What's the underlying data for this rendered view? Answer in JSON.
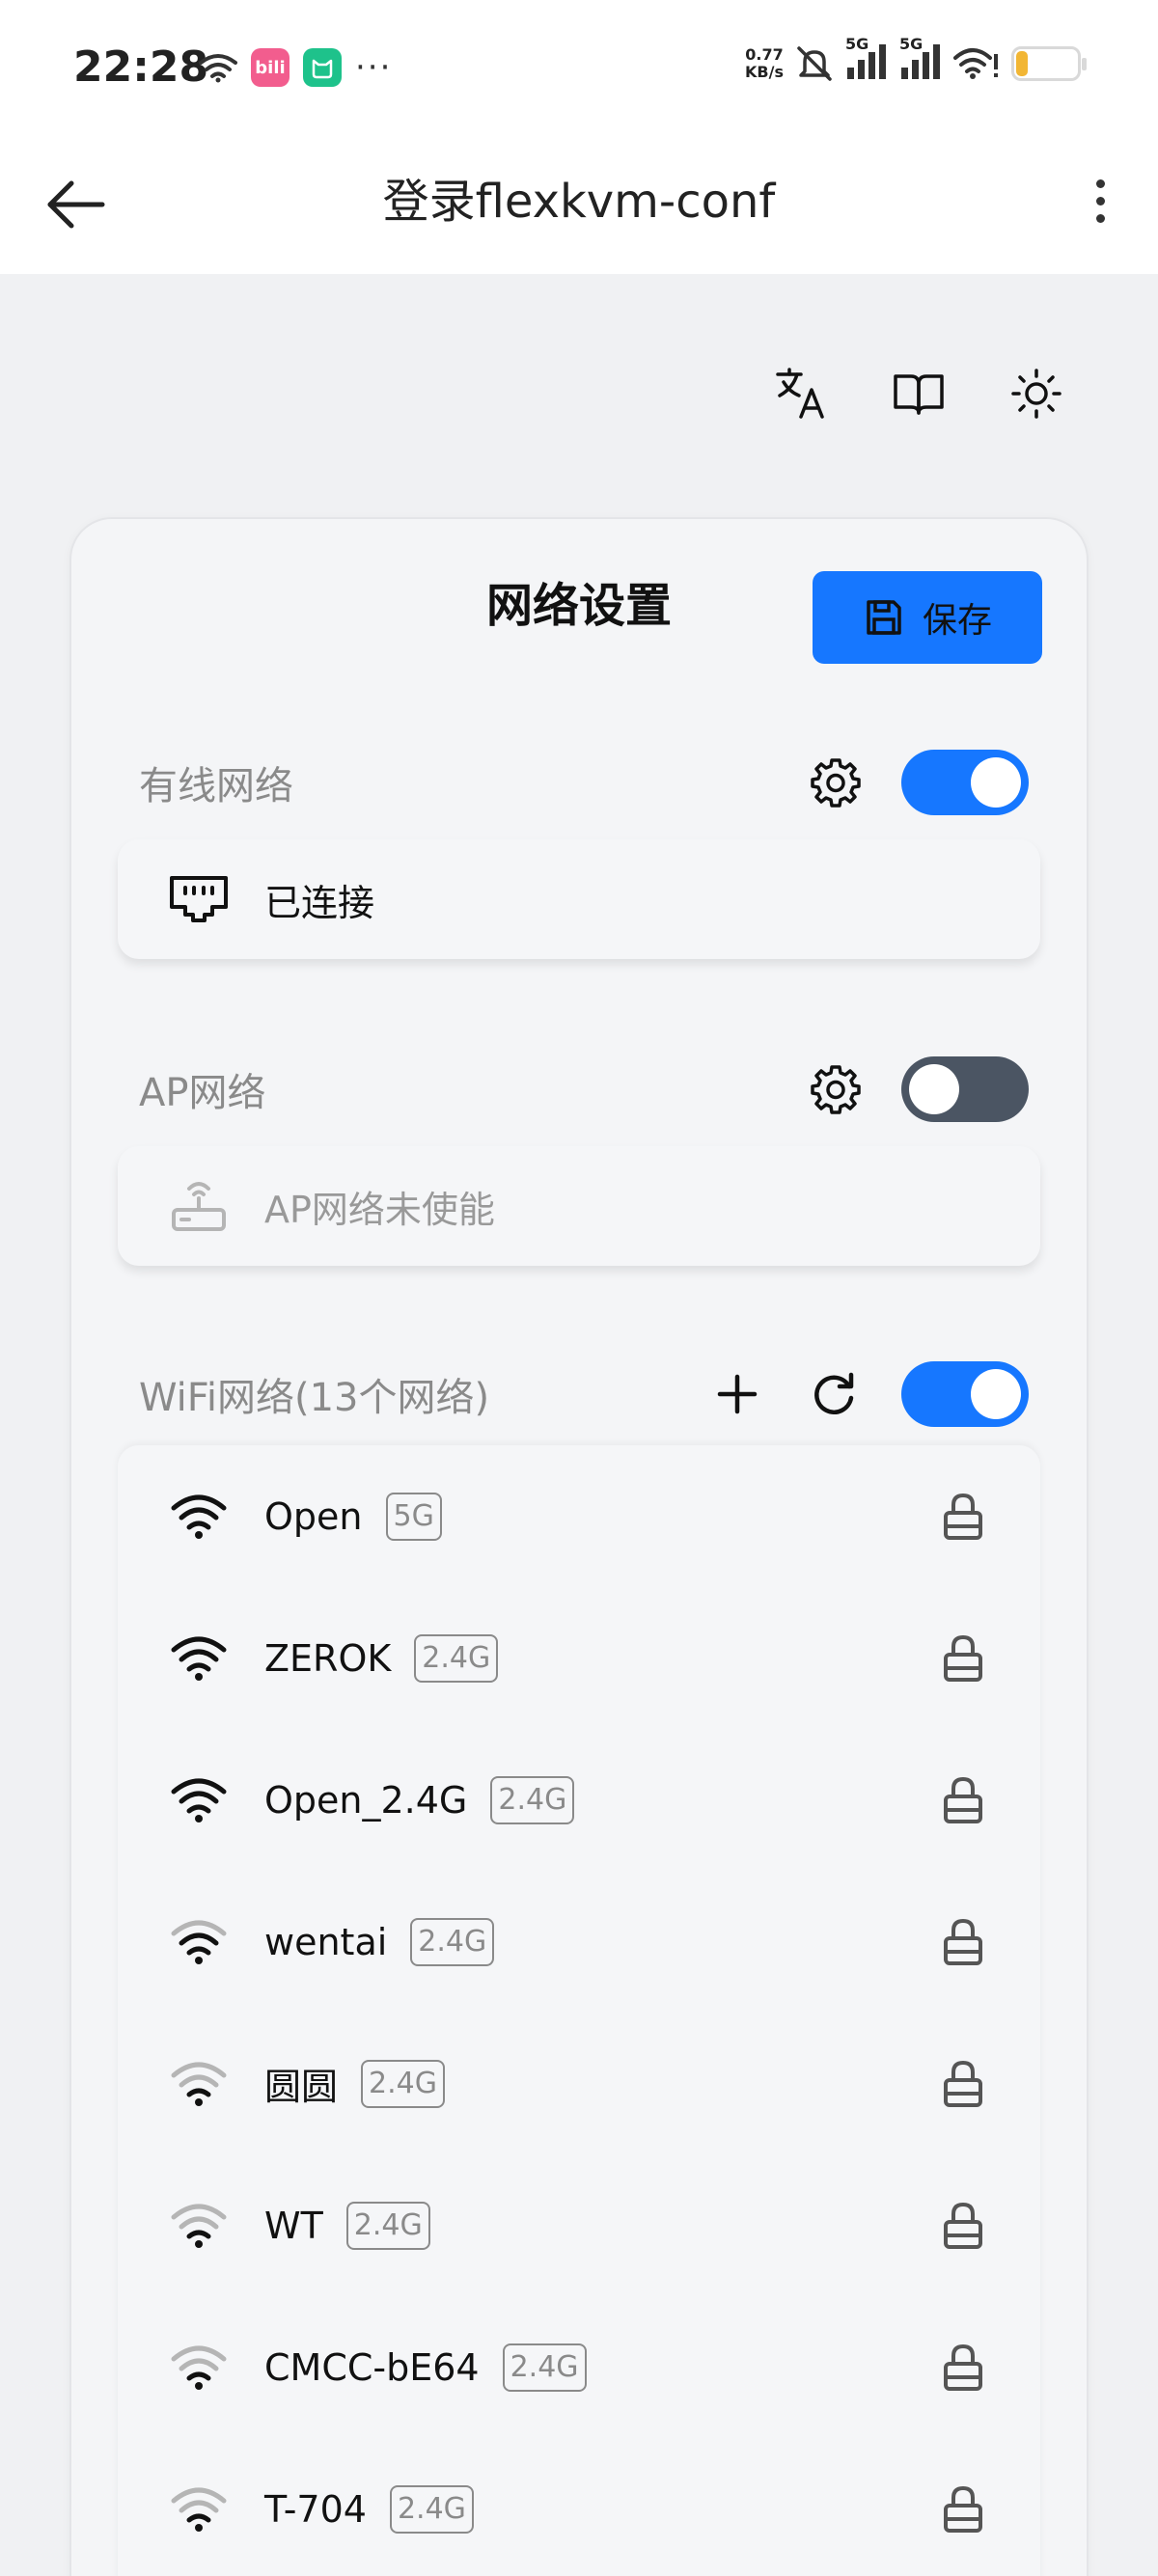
{
  "status_bar": {
    "time": "22:28",
    "app1": "bili",
    "net_speed_value": "0.77",
    "net_speed_unit": "KB/s",
    "sim1": "5G",
    "sim2": "5G",
    "battery": "20",
    "battery_level": 0.2
  },
  "app_bar": {
    "title": "登录flexkvm-conf"
  },
  "card": {
    "title": "网络设置",
    "save_label": "保存",
    "wired": {
      "title": "有线网络",
      "enabled": true,
      "status": "已连接"
    },
    "ap": {
      "title": "AP网络",
      "enabled": false,
      "status": "AP网络未使能"
    },
    "wifi": {
      "title": "WiFi网络(13个网络)",
      "enabled": true,
      "networks": [
        {
          "ssid": "Open",
          "band": "5G",
          "strength": "strong"
        },
        {
          "ssid": "ZEROK",
          "band": "2.4G",
          "strength": "strong"
        },
        {
          "ssid": "Open_2.4G",
          "band": "2.4G",
          "strength": "strong"
        },
        {
          "ssid": "wentai",
          "band": "2.4G",
          "strength": "medium"
        },
        {
          "ssid": "圆圆",
          "band": "2.4G",
          "strength": "weak"
        },
        {
          "ssid": "WT",
          "band": "2.4G",
          "strength": "weak"
        },
        {
          "ssid": "CMCC-bE64",
          "band": "2.4G",
          "strength": "weak"
        },
        {
          "ssid": "T-704",
          "band": "2.4G",
          "strength": "weak"
        }
      ]
    }
  },
  "colors": {
    "accent": "#1677ff",
    "toggle_off": "#4b5563",
    "muted_text": "#8a8a8a",
    "battery": "#f2b634"
  },
  "icons": {
    "back": "arrow-left-icon",
    "more": "more-vertical-icon",
    "translate": "translate-icon",
    "docs": "book-open-icon",
    "theme": "sun-icon",
    "save": "save-icon",
    "settings": "gear-icon",
    "ethernet": "ethernet-port-icon",
    "router": "router-icon",
    "add": "plus-icon",
    "refresh": "refresh-icon",
    "wifi": "wifi-icon",
    "lock": "lock-icon"
  }
}
